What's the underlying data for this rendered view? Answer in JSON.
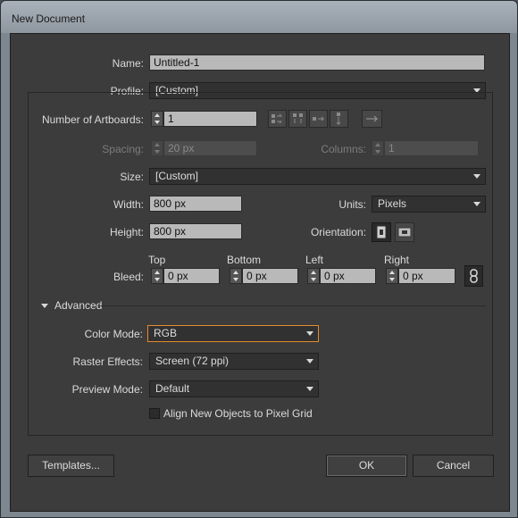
{
  "window": {
    "title": "New Document"
  },
  "name": {
    "label": "Name:",
    "value": "Untitled-1"
  },
  "profile": {
    "label": "Profile:",
    "value": "[Custom]"
  },
  "artboards": {
    "label": "Number of Artboards:",
    "value": "1"
  },
  "spacing": {
    "label": "Spacing:",
    "value": "20 px"
  },
  "columns": {
    "label": "Columns:",
    "value": "1"
  },
  "size": {
    "label": "Size:",
    "value": "[Custom]"
  },
  "width": {
    "label": "Width:",
    "value": "800 px"
  },
  "units": {
    "label": "Units:",
    "value": "Pixels"
  },
  "height": {
    "label": "Height:",
    "value": "800 px"
  },
  "orientation": {
    "label": "Orientation:"
  },
  "bleed": {
    "label": "Bleed:",
    "top": {
      "label": "Top",
      "value": "0 px"
    },
    "bottom": {
      "label": "Bottom",
      "value": "0 px"
    },
    "left": {
      "label": "Left",
      "value": "0 px"
    },
    "right": {
      "label": "Right",
      "value": "0 px"
    }
  },
  "advanced": {
    "label": "Advanced"
  },
  "color_mode": {
    "label": "Color Mode:",
    "value": "RGB"
  },
  "raster_effects": {
    "label": "Raster Effects:",
    "value": "Screen (72 ppi)"
  },
  "preview_mode": {
    "label": "Preview Mode:",
    "value": "Default"
  },
  "align_pixel_grid": {
    "label": "Align New Objects to Pixel Grid",
    "checked": false
  },
  "buttons": {
    "templates": "Templates...",
    "ok": "OK",
    "cancel": "Cancel"
  },
  "colors": {
    "dialog_bg": "#3c3c3c",
    "field_bg": "#b9b9b9",
    "focus_border": "#e58a2c",
    "text": "#dcdcdc"
  }
}
